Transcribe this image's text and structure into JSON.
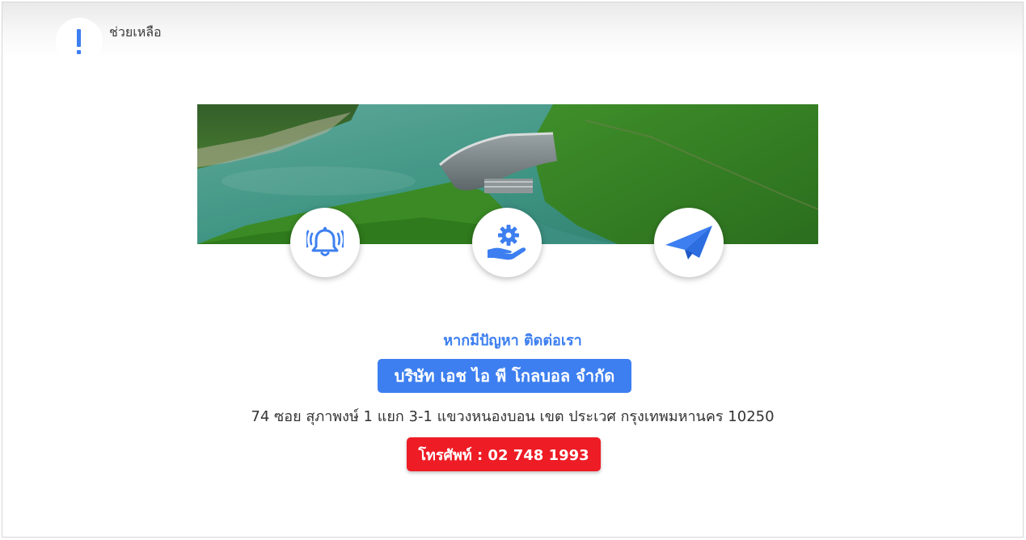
{
  "header": {
    "help_label": "ช่วยเหลือ",
    "help_icon": "exclamation-icon"
  },
  "banner": {
    "image": "aerial view of hydroelectric dam with reservoir and forested hills"
  },
  "feature_icons": [
    {
      "icon": "bell-alarm-icon"
    },
    {
      "icon": "gear-hand-icon"
    },
    {
      "icon": "paper-plane-icon"
    }
  ],
  "contact": {
    "heading": "หากมีปัญหา ติดต่อเรา",
    "company": "บริษัท เอช ไอ พี โกลบอล จำกัด",
    "address": "74 ซอย สุภาพงษ์ 1 แยก 3-1 แขวงหนองบอน เขต ประเวศ กรุงเทพมหานคร 10250",
    "phone_label": "โทรศัพท์ : 02 748 1993"
  },
  "colors": {
    "accent": "#3d7ff0",
    "phone": "#ee1c25"
  }
}
